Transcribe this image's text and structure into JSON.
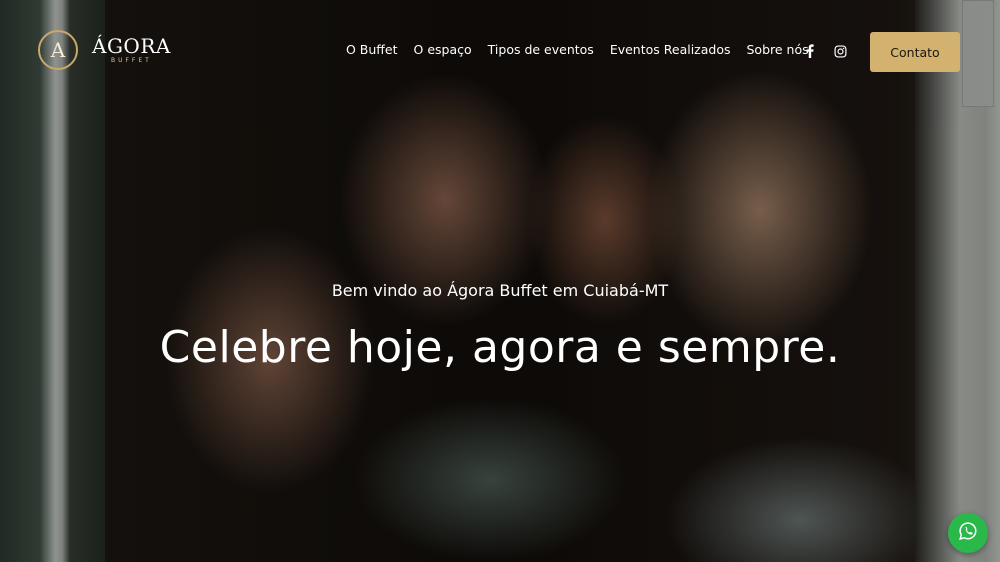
{
  "brand": {
    "emblem_letter": "A",
    "name": "ÁGORA",
    "sub": "BUFFET",
    "accent_color": "#d3b26f"
  },
  "nav": {
    "items": [
      {
        "label": "O Buffet"
      },
      {
        "label": "O espaço"
      },
      {
        "label": "Tipos de eventos"
      },
      {
        "label": "Eventos Realizados"
      },
      {
        "label": "Sobre nós"
      }
    ],
    "social_icons": [
      "facebook-icon",
      "instagram-icon"
    ],
    "cta_label": "Contato"
  },
  "hero": {
    "welcome": "Bem vindo ao Ágora Buffet em Cuiabá-MT",
    "headline": "Celebre hoje, agora e sempre."
  },
  "floating": {
    "icon": "whatsapp-icon",
    "color": "#2ab84a"
  }
}
